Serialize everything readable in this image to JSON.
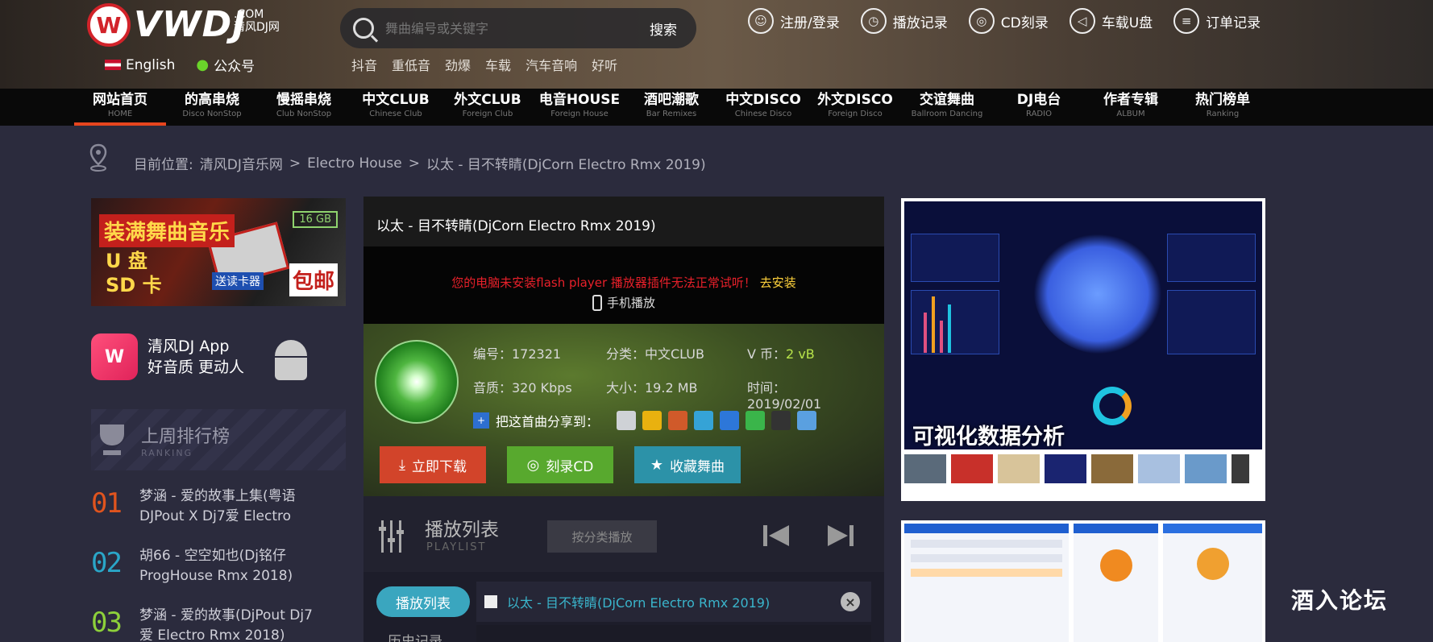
{
  "header": {
    "logo_text": "VWDJ",
    "logo_com": ".COM",
    "logo_cn": "清风DJ网",
    "lang_english": "English",
    "lang_wechat": "公众号",
    "search_placeholder": "舞曲编号或关键字",
    "search_button": "搜索",
    "hotwords": [
      "抖音",
      "重低音",
      "劲爆",
      "车载",
      "汽车音响",
      "好听"
    ],
    "toplinks": [
      {
        "label": "注册/登录",
        "icon": "user-icon"
      },
      {
        "label": "播放记录",
        "icon": "clock-icon"
      },
      {
        "label": "CD刻录",
        "icon": "cd-icon"
      },
      {
        "label": "车载U盘",
        "icon": "speaker-icon"
      },
      {
        "label": "订单记录",
        "icon": "order-icon"
      }
    ]
  },
  "nav": [
    {
      "title": "网站首页",
      "sub": "HOME",
      "active": true
    },
    {
      "title": "的高串烧",
      "sub": "Disco NonStop"
    },
    {
      "title": "慢摇串烧",
      "sub": "Club NonStop"
    },
    {
      "title": "中文CLUB",
      "sub": "Chinese Club"
    },
    {
      "title": "外文CLUB",
      "sub": "Foreign Club"
    },
    {
      "title": "电音HOUSE",
      "sub": "Foreign House"
    },
    {
      "title": "酒吧潮歌",
      "sub": "Bar Remixes"
    },
    {
      "title": "中文DISCO",
      "sub": "Chinese Disco"
    },
    {
      "title": "外文DISCO",
      "sub": "Foreign Disco"
    },
    {
      "title": "交谊舞曲",
      "sub": "Ballroom Dancing"
    },
    {
      "title": "DJ电台",
      "sub": "RADIO"
    },
    {
      "title": "作者专辑",
      "sub": "ALBUM"
    },
    {
      "title": "热门榜单",
      "sub": "Ranking"
    }
  ],
  "breadcrumb": {
    "label": "目前位置:",
    "items": [
      "清风DJ音乐网",
      "Electro House",
      "以太 - 目不转睛(DjCorn Electro Rmx 2019)"
    ],
    "separator": ">"
  },
  "left": {
    "banner": {
      "title": "装满舞曲音乐",
      "line1": "U 盘",
      "line2": "SD 卡",
      "capacity": "16 GB",
      "ship": "包邮",
      "gift": "送读卡器"
    },
    "app": {
      "logo": "W",
      "line1": "清风DJ App",
      "line2": "好音质  更动人"
    },
    "ranking": {
      "title": "上周排行榜",
      "sub": "RANKING"
    },
    "rank_items": [
      {
        "num": "01",
        "color": "#e0541e",
        "text1": "梦涵 - 爱的故事上集(粤语",
        "text2": "DJPout X Dj7爱 Electro"
      },
      {
        "num": "02",
        "color": "#2aa6c8",
        "text1": "胡66 - 空空如也(Dj铭仔",
        "text2": "ProgHouse Rmx 2018)"
      },
      {
        "num": "03",
        "color": "#8dd03a",
        "text1": "梦涵 - 爱的故事(DjPout Dj7",
        "text2": "爱 Electro Rmx 2018)"
      }
    ]
  },
  "song": {
    "title": "以太 - 目不转睛(DjCorn Electro Rmx 2019)",
    "flash_warning": "您的电脑未安装flash player 播放器插件无法正常试听！",
    "flash_install": "去安装",
    "mobile_play": "手机播放",
    "meta": {
      "id": "编号：172321",
      "category": "分类：中文CLUB",
      "vcoin_label": "V 币：",
      "vcoin": "2 vB",
      "bitrate": "音质：320 Kbps",
      "size": "大小：19.2 MB",
      "date": "时间：2019/02/01"
    },
    "share_label": "把这首曲分享到：",
    "share_colors": [
      "#cfd2d6",
      "#e9b10f",
      "#d05a2a",
      "#35a3d6",
      "#2d77d9",
      "#3ab54a",
      "#333333",
      "#5aa0e0"
    ],
    "buttons": {
      "download": "立即下载",
      "burn_cd": "刻录CD",
      "favorite": "收藏舞曲"
    }
  },
  "playlist": {
    "title": "播放列表",
    "sub": "PLAYLIST",
    "category_button": "按分类播放",
    "tab_active": "播放列表",
    "tab_history": "历史记录",
    "rows": [
      "以太 - 目不转睛(DjCorn Electro Rmx 2019)"
    ]
  },
  "right": {
    "ad1_title": "可视化数据分析"
  },
  "watermark": "酒入论坛",
  "colors": {
    "accent_red": "#e7451e",
    "download": "#d2442a",
    "burn": "#58a92e",
    "favorite": "#2c92a8",
    "playlist_link": "#3ab5cc"
  }
}
